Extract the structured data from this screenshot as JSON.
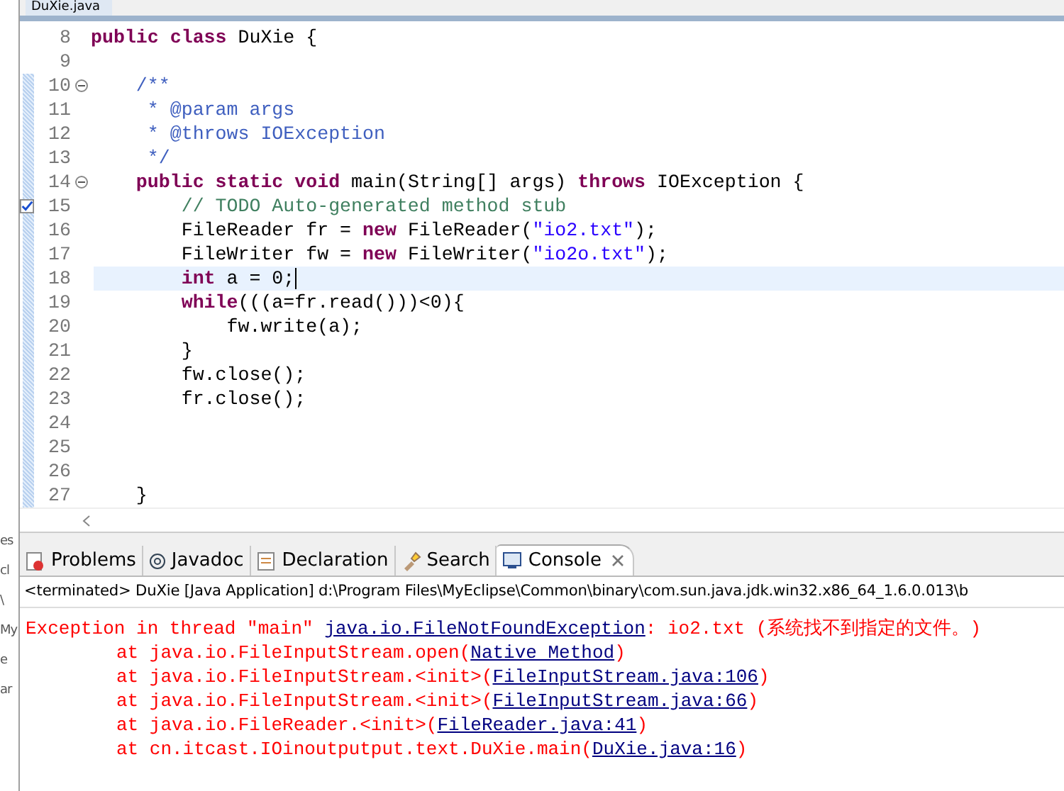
{
  "editor_tab": {
    "title": "DuXie.java"
  },
  "left_strip": [
    "es",
    "cl",
    "\\",
    "My",
    "e",
    "ar"
  ],
  "editor": {
    "lines": [
      {
        "number": "8",
        "fold": false,
        "task": false,
        "current": false,
        "tokens": [
          {
            "kind": "keyword",
            "text": "public "
          },
          {
            "kind": "keyword",
            "text": "class "
          },
          {
            "kind": "plain",
            "text": "DuXie {"
          }
        ]
      },
      {
        "number": "9",
        "fold": false,
        "task": false,
        "current": false
      },
      {
        "number": "10",
        "fold": true,
        "task": false,
        "current": false,
        "tokens": [
          {
            "kind": "javadoc",
            "text": "    /**"
          }
        ]
      },
      {
        "number": "11",
        "fold": false,
        "task": false,
        "current": false,
        "tokens": [
          {
            "kind": "javadoc",
            "text": "     * @param args"
          }
        ]
      },
      {
        "number": "12",
        "fold": false,
        "task": false,
        "current": false,
        "tokens": [
          {
            "kind": "javadoc",
            "text": "     * @throws IOException"
          }
        ]
      },
      {
        "number": "13",
        "fold": false,
        "task": false,
        "current": false,
        "tokens": [
          {
            "kind": "javadoc",
            "text": "     */"
          }
        ]
      },
      {
        "number": "14",
        "fold": true,
        "task": false,
        "current": false,
        "tokens": [
          {
            "kind": "keyword",
            "text": "    public "
          },
          {
            "kind": "keyword",
            "text": "static "
          },
          {
            "kind": "keyword",
            "text": "void "
          },
          {
            "kind": "plain",
            "text": "main(String[] args) "
          },
          {
            "kind": "keyword",
            "text": "throws "
          },
          {
            "kind": "plain",
            "text": "IOException {"
          }
        ]
      },
      {
        "number": "15",
        "fold": false,
        "task": true,
        "current": false,
        "tokens": [
          {
            "kind": "comment",
            "text": "        // TODO Auto-generated method stub"
          }
        ]
      },
      {
        "number": "16",
        "fold": false,
        "task": false,
        "current": false,
        "tokens": [
          {
            "kind": "plain",
            "text": "        FileReader fr = "
          },
          {
            "kind": "keyword",
            "text": "new "
          },
          {
            "kind": "plain",
            "text": "FileReader("
          },
          {
            "kind": "string",
            "text": "\"io2.txt\""
          },
          {
            "kind": "plain",
            "text": ");"
          }
        ]
      },
      {
        "number": "17",
        "fold": false,
        "task": false,
        "current": false,
        "tokens": [
          {
            "kind": "plain",
            "text": "        FileWriter fw = "
          },
          {
            "kind": "keyword",
            "text": "new "
          },
          {
            "kind": "plain",
            "text": "FileWriter("
          },
          {
            "kind": "string",
            "text": "\"io2o.txt\""
          },
          {
            "kind": "plain",
            "text": ");"
          }
        ]
      },
      {
        "number": "18",
        "fold": false,
        "task": false,
        "current": true,
        "tokens": [
          {
            "kind": "keyword",
            "text": "        int "
          },
          {
            "kind": "plain",
            "text": "a = 0;"
          }
        ]
      },
      {
        "number": "19",
        "fold": false,
        "task": false,
        "current": false,
        "tokens": [
          {
            "kind": "keyword",
            "text": "        while"
          },
          {
            "kind": "plain",
            "text": "(((a=fr.read()))<0){"
          }
        ]
      },
      {
        "number": "20",
        "fold": false,
        "task": false,
        "current": false,
        "tokens": [
          {
            "kind": "plain",
            "text": "            fw.write(a);"
          }
        ]
      },
      {
        "number": "21",
        "fold": false,
        "task": false,
        "current": false,
        "tokens": [
          {
            "kind": "plain",
            "text": "        }"
          }
        ]
      },
      {
        "number": "22",
        "fold": false,
        "task": false,
        "current": false,
        "tokens": [
          {
            "kind": "plain",
            "text": "        fw.close();"
          }
        ]
      },
      {
        "number": "23",
        "fold": false,
        "task": false,
        "current": false,
        "tokens": [
          {
            "kind": "plain",
            "text": "        fr.close();"
          }
        ]
      },
      {
        "number": "24",
        "fold": false,
        "task": false,
        "current": false
      },
      {
        "number": "25",
        "fold": false,
        "task": false,
        "current": false
      },
      {
        "number": "26",
        "fold": false,
        "task": false,
        "current": false
      },
      {
        "number": "27",
        "fold": false,
        "task": false,
        "current": false,
        "tokens": [
          {
            "kind": "plain",
            "text": "    }"
          }
        ]
      }
    ]
  },
  "panel_tabs": [
    {
      "label": "Problems",
      "kind": "problems",
      "selected": false
    },
    {
      "label": "Javadoc",
      "kind": "javadoc",
      "selected": false
    },
    {
      "label": "Declaration",
      "kind": "declaration",
      "selected": false
    },
    {
      "label": "Search",
      "kind": "search",
      "selected": false
    },
    {
      "label": "Console",
      "kind": "console",
      "selected": true
    }
  ],
  "console": {
    "header": "<terminated> DuXie [Java Application] d:\\Program Files\\MyEclipse\\Common\\binary\\com.sun.java.jdk.win32.x86_64_1.6.0.013\\b",
    "lines": [
      {
        "indented": false,
        "segments": [
          {
            "kind": "text",
            "text": "Exception in thread \"main\" "
          },
          {
            "kind": "link",
            "text": "java.io.FileNotFoundException"
          },
          {
            "kind": "text",
            "text": ": io2.txt (系统找不到指定的文件。)"
          }
        ]
      },
      {
        "indented": true,
        "segments": [
          {
            "kind": "text",
            "text": "at java.io.FileInputStream.open("
          },
          {
            "kind": "link",
            "text": "Native Method"
          },
          {
            "kind": "text",
            "text": ")"
          }
        ]
      },
      {
        "indented": true,
        "segments": [
          {
            "kind": "text",
            "text": "at java.io.FileInputStream.<init>("
          },
          {
            "kind": "link",
            "text": "FileInputStream.java:106"
          },
          {
            "kind": "text",
            "text": ")"
          }
        ]
      },
      {
        "indented": true,
        "segments": [
          {
            "kind": "text",
            "text": "at java.io.FileInputStream.<init>("
          },
          {
            "kind": "link",
            "text": "FileInputStream.java:66"
          },
          {
            "kind": "text",
            "text": ")"
          }
        ]
      },
      {
        "indented": true,
        "segments": [
          {
            "kind": "text",
            "text": "at java.io.FileReader.<init>("
          },
          {
            "kind": "link",
            "text": "FileReader.java:41"
          },
          {
            "kind": "text",
            "text": ")"
          }
        ]
      },
      {
        "indented": true,
        "segments": [
          {
            "kind": "text",
            "text": "at cn.itcast.IOinoutputput.text.DuXie.main("
          },
          {
            "kind": "link",
            "text": "DuXie.java:16"
          },
          {
            "kind": "text",
            "text": ")"
          }
        ]
      }
    ]
  }
}
